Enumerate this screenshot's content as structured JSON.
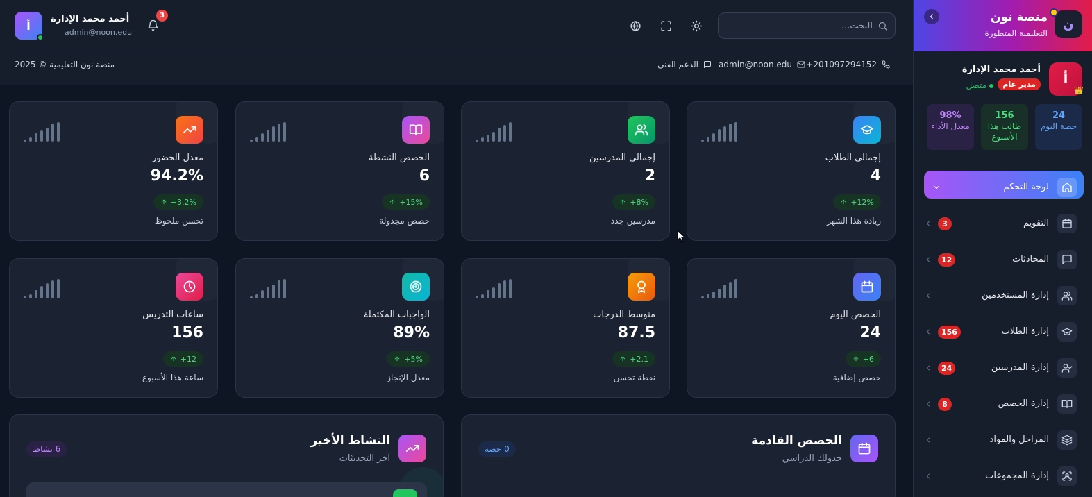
{
  "sidebar": {
    "brand_name": "منصة نون",
    "brand_tagline": "التعليمية المتطورة",
    "brand_logo_letter": "ن",
    "profile": {
      "initial": "أ",
      "name": "أحمد محمد الإدارة",
      "role": "مدير عام",
      "status": "متصل"
    },
    "stats": [
      {
        "value": "24",
        "label": "حصة اليوم",
        "color": "#60a5fa"
      },
      {
        "value": "156",
        "label": "طالب هذا الأسبوع",
        "color": "#4ade80"
      },
      {
        "value": "98%",
        "label": "معدل الأداء",
        "color": "#c084fc"
      }
    ],
    "nav": [
      {
        "label": "لوحة التحكم",
        "icon": "home-icon",
        "badge": "",
        "active": true
      },
      {
        "label": "التقويم",
        "icon": "calendar-icon",
        "badge": "3"
      },
      {
        "label": "المحادثات",
        "icon": "chat-icon",
        "badge": "12"
      },
      {
        "label": "إدارة المستخدمين",
        "icon": "users-icon",
        "badge": ""
      },
      {
        "label": "إدارة الطلاب",
        "icon": "graduation-cap-icon",
        "badge": "156"
      },
      {
        "label": "إدارة المدرسين",
        "icon": "user-check-icon",
        "badge": "24"
      },
      {
        "label": "إدارة الحصص",
        "icon": "book-icon",
        "badge": "8"
      },
      {
        "label": "المراحل والمواد",
        "icon": "layers-icon",
        "badge": ""
      },
      {
        "label": "إدارة المجموعات",
        "icon": "group-icon",
        "badge": ""
      }
    ]
  },
  "header": {
    "search_placeholder": "البحث...",
    "notifications_count": "3",
    "user": {
      "initial": "أ",
      "name": "أحمد محمد الإدارة",
      "email": "admin@noon.edu"
    },
    "contact": {
      "phone": "+201097294152",
      "email": "admin@noon.edu",
      "support": "الدعم الفني",
      "copyright": "منصة نون التعليمية © 2025"
    }
  },
  "stat_cards": [
    {
      "label": "إجمالي الطلاب",
      "value": "4",
      "change": "+12%",
      "footer": "زيادة هذا الشهر",
      "icon": "graduation-cap-icon",
      "color": "#3b82f6",
      "color2": "#06b6d4"
    },
    {
      "label": "إجمالي المدرسين",
      "value": "2",
      "change": "+8%",
      "footer": "مدرسين جدد",
      "icon": "users-icon",
      "color": "#22c55e",
      "color2": "#059669"
    },
    {
      "label": "الحصص النشطة",
      "value": "6",
      "change": "+15%",
      "footer": "حصص مجدولة",
      "icon": "book-open-icon",
      "color": "#a855f7",
      "color2": "#ec4899"
    },
    {
      "label": "معدل الحضور",
      "value": "94.2%",
      "change": "+3.2%",
      "footer": "تحسن ملحوظ",
      "icon": "trending-up-icon",
      "color": "#f97316",
      "color2": "#ef4444"
    },
    {
      "label": "الحصص اليوم",
      "value": "24",
      "change": "+6",
      "footer": "حصص إضافية",
      "icon": "calendar-icon",
      "color": "#6366f1",
      "color2": "#3b82f6"
    },
    {
      "label": "متوسط الدرجات",
      "value": "87.5",
      "change": "+2.1",
      "footer": "نقطة تحسن",
      "icon": "award-icon",
      "color": "#f59e0b",
      "color2": "#ea580c"
    },
    {
      "label": "الواجبات المكتملة",
      "value": "89%",
      "change": "+5%",
      "footer": "معدل الإنجاز",
      "icon": "target-icon",
      "color": "#14b8a6",
      "color2": "#06b6d4"
    },
    {
      "label": "ساعات التدريس",
      "value": "156",
      "change": "+12",
      "footer": "ساعة هذا الأسبوع",
      "icon": "clock-icon",
      "color": "#ec4899",
      "color2": "#e11d48"
    }
  ],
  "panels": {
    "upcoming": {
      "title": "الحصص القادمة",
      "subtitle": "جدولك الدراسي",
      "count": "0 حصة"
    },
    "activity": {
      "title": "النشاط الأخير",
      "subtitle": "آخر التحديثات",
      "count": "6 نشاط"
    }
  }
}
